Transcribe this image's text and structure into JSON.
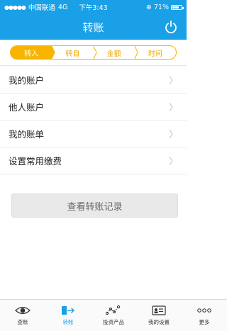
{
  "statusbar": {
    "carrier": "中国联通",
    "network": "4G",
    "time": "下午3:43",
    "battery": "71%",
    "battery_level": 0.71
  },
  "header": {
    "title": "转账"
  },
  "steps": [
    {
      "label": "转入",
      "active": true
    },
    {
      "label": "转自",
      "active": false
    },
    {
      "label": "金额",
      "active": false
    },
    {
      "label": "时间",
      "active": false
    }
  ],
  "menu": [
    {
      "label": "我的账户"
    },
    {
      "label": "他人账户"
    },
    {
      "label": "我的账单"
    },
    {
      "label": "设置常用缴费"
    }
  ],
  "query_button": {
    "label": "查看转账记录"
  },
  "tabbar": [
    {
      "label": "查账",
      "icon": "eye-icon",
      "active": false
    },
    {
      "label": "转账",
      "icon": "transfer-icon",
      "active": true
    },
    {
      "label": "投资产品",
      "icon": "chart-icon",
      "active": false
    },
    {
      "label": "我的设置",
      "icon": "id-card-icon",
      "active": false
    },
    {
      "label": "更多",
      "icon": "more-icon",
      "active": false
    }
  ],
  "colors": {
    "primary": "#1aa0e6",
    "accent": "#f7b500"
  }
}
